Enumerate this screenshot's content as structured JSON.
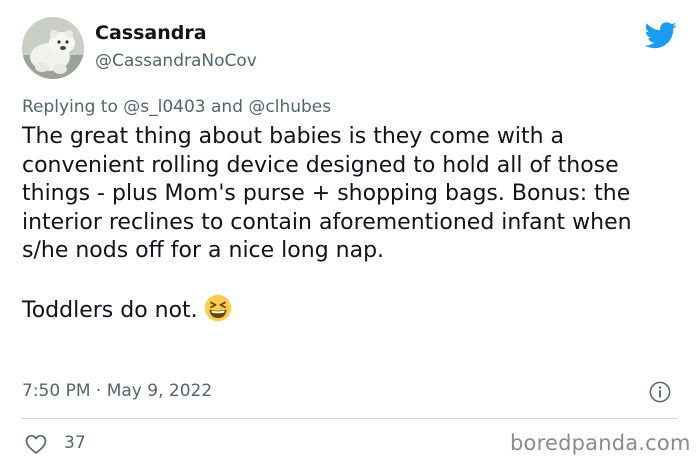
{
  "tweet": {
    "author_name": "Cassandra",
    "author_handle": "@CassandraNoCov",
    "reply_prefix": "Replying to",
    "reply_to_1": "@s_l0403",
    "reply_and": "and",
    "reply_to_2": "@clhubes",
    "paragraph_1": "The great thing about babies is they come with a convenient rolling device designed to hold all of those things - plus Mom's purse + shopping bags. Bonus: the interior reclines to contain aforementioned infant when s/he nods off for a nice long nap.",
    "paragraph_2": "Toddlers do not.",
    "timestamp": "7:50 PM · May 9, 2022",
    "like_count": "37"
  },
  "watermark": "boredpanda.com",
  "icons": {
    "avatar": "avatar-photo-polar-bear",
    "brand": "twitter-bird-icon",
    "emoji": "grinning-squinting-face-icon",
    "info": "info-icon",
    "like": "heart-icon"
  },
  "colors": {
    "text_primary": "#0f1419",
    "text_secondary": "#536471",
    "twitter_blue": "#1d9bf0",
    "divider": "#cfd9de",
    "emoji_yellow": "#ffcc4d"
  }
}
